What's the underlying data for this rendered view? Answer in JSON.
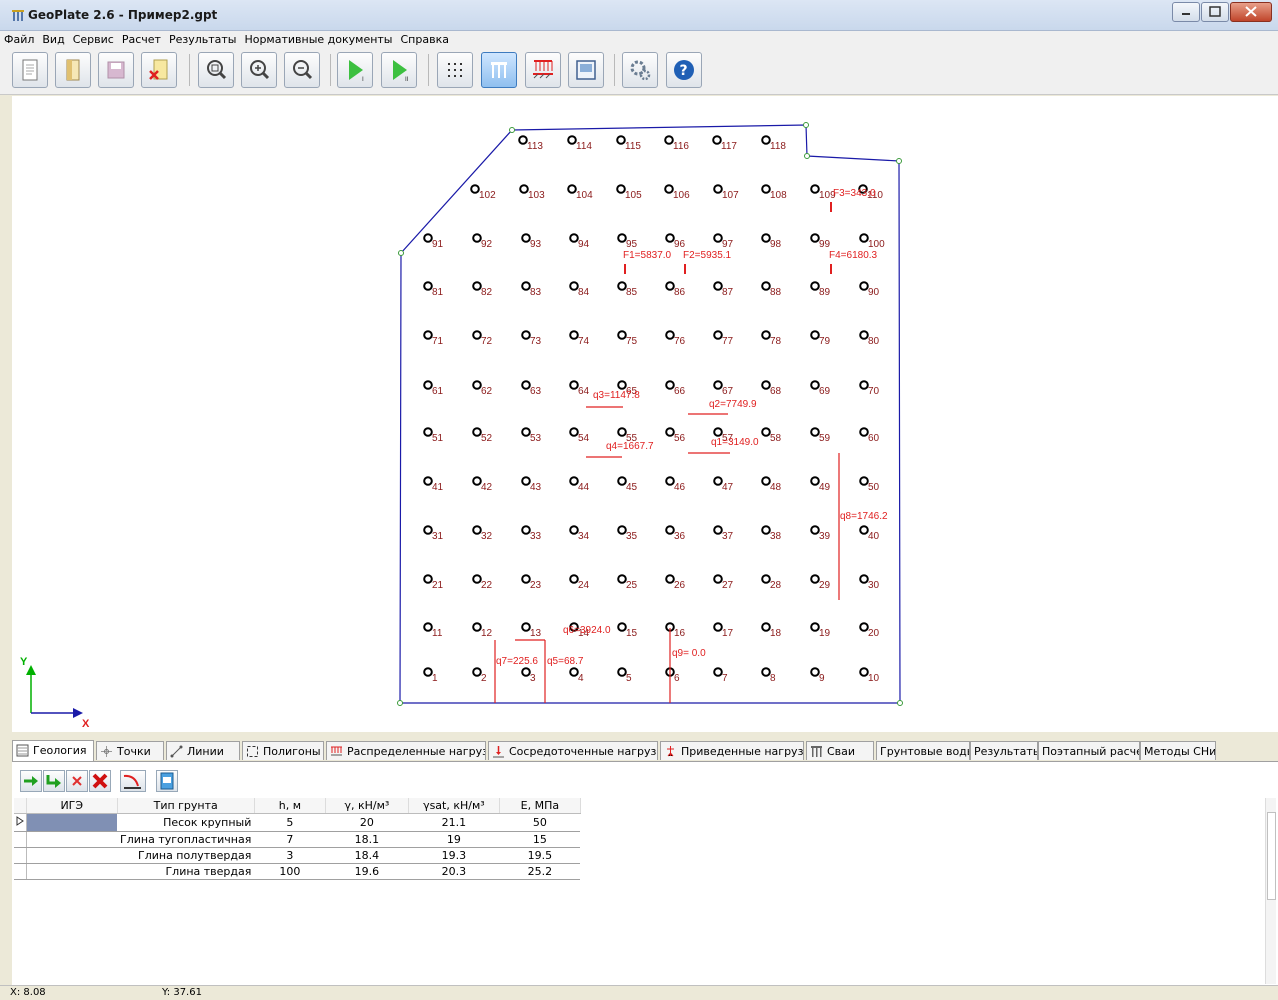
{
  "window": {
    "title": "GeoPlate 2.6  -  Пример2.gpt"
  },
  "menu": [
    "Файл",
    "Вид",
    "Сервис",
    "Расчет",
    "Результаты",
    "Нормативные документы",
    "Справка"
  ],
  "toolbar": {
    "buttons": [
      {
        "name": "new-file",
        "icon": "new-file-icon"
      },
      {
        "name": "open-file",
        "icon": "open-folder-icon"
      },
      {
        "name": "save-file",
        "icon": "save-icon"
      },
      {
        "name": "close-file",
        "icon": "close-file-icon"
      },
      {
        "name": "zoom-fit",
        "icon": "zoom-fit-icon"
      },
      {
        "name": "zoom-in",
        "icon": "zoom-in-icon"
      },
      {
        "name": "zoom-out",
        "icon": "zoom-out-icon"
      },
      {
        "name": "run-calc-1",
        "icon": "play-icon"
      },
      {
        "name": "run-calc-2",
        "icon": "play-icon"
      },
      {
        "name": "show-grid",
        "icon": "grid-dots-icon"
      },
      {
        "name": "show-piles",
        "icon": "piles-icon"
      },
      {
        "name": "show-loads",
        "icon": "distributed-load-icon"
      },
      {
        "name": "report",
        "icon": "report-icon"
      },
      {
        "name": "settings",
        "icon": "gear-icon"
      },
      {
        "name": "help",
        "icon": "help-icon"
      }
    ]
  },
  "drawing": {
    "axis_x_label": "X",
    "axis_y_label": "Y",
    "pile_ids": [
      [
        "113",
        "114",
        "115",
        "116",
        "117",
        "118"
      ],
      [
        "102",
        "103",
        "104",
        "105",
        "106",
        "107",
        "108",
        "109",
        "110"
      ],
      [
        "91",
        "92",
        "93",
        "94",
        "95",
        "96",
        "97",
        "98",
        "99",
        "100"
      ],
      [
        "81",
        "82",
        "83",
        "84",
        "85",
        "86",
        "87",
        "88",
        "89",
        "90"
      ],
      [
        "71",
        "72",
        "73",
        "74",
        "75",
        "76",
        "77",
        "78",
        "79",
        "80"
      ],
      [
        "61",
        "62",
        "63",
        "64",
        "65",
        "66",
        "67",
        "68",
        "69",
        "70"
      ],
      [
        "51",
        "52",
        "53",
        "54",
        "55",
        "56",
        "57",
        "58",
        "59",
        "60"
      ],
      [
        "41",
        "42",
        "43",
        "44",
        "45",
        "46",
        "47",
        "48",
        "49",
        "50"
      ],
      [
        "31",
        "32",
        "33",
        "34",
        "35",
        "36",
        "37",
        "38",
        "39",
        "40"
      ],
      [
        "21",
        "22",
        "23",
        "24",
        "25",
        "26",
        "27",
        "28",
        "29",
        "30"
      ],
      [
        "11",
        "12",
        "13",
        "14",
        "15",
        "16",
        "17",
        "18",
        "19",
        "20"
      ],
      [
        "1",
        "2",
        "3",
        "4",
        "5",
        "6",
        "7",
        "8",
        "9",
        "10"
      ]
    ],
    "point_loads": [
      {
        "label": "F1=5837.0"
      },
      {
        "label": "F2=5935.1"
      },
      {
        "label": "F3=343.0"
      },
      {
        "label": "F4=6180.3"
      }
    ],
    "line_loads": [
      {
        "label": "q1=3149.0"
      },
      {
        "label": "q2=7749.9"
      },
      {
        "label": "q3=1147.8"
      },
      {
        "label": "q4=1667.7"
      },
      {
        "label": "q5=68.7"
      },
      {
        "label": "q6=3924.0"
      },
      {
        "label": "q7=225.6"
      },
      {
        "label": "q8=1746.2"
      },
      {
        "label": "q9= 0.0"
      }
    ],
    "colors": {
      "outline": "#1a1aa8",
      "load": "#e02020",
      "pile": "#000000",
      "pile_label": "#8b1a1a",
      "axis_x": "#1a1aa8",
      "axis_y": "#00b000"
    }
  },
  "tabs": [
    {
      "label": "Геология",
      "icon": "geology-icon",
      "active": true
    },
    {
      "label": "Точки",
      "icon": "point-icon"
    },
    {
      "label": "Линии",
      "icon": "line-icon"
    },
    {
      "label": "Полигоны",
      "icon": "polygon-icon"
    },
    {
      "label": "Распределенные нагрузки",
      "icon": "distributed-load-icon"
    },
    {
      "label": "Сосредоточенные нагрузки",
      "icon": "point-load-icon"
    },
    {
      "label": "Приведенные нагрузки",
      "icon": "reduced-load-icon"
    },
    {
      "label": "Сваи",
      "icon": "piles-icon"
    },
    {
      "label": "Грунтовые воды"
    },
    {
      "label": "Результаты"
    },
    {
      "label": "Поэтапный расчет"
    },
    {
      "label": "Методы СНиП"
    }
  ],
  "geology_table": {
    "columns": [
      "ИГЭ",
      "Тип грунта",
      "h, м",
      "γ, кН/м³",
      "γsat, кН/м³",
      "E, МПа"
    ],
    "rows": [
      [
        "",
        "Песок крупный",
        "5",
        "20",
        "21.1",
        "50"
      ],
      [
        "",
        "Глина тугопластичная",
        "7",
        "18.1",
        "19",
        "15"
      ],
      [
        "",
        "Глина полутвердая",
        "3",
        "18.4",
        "19.3",
        "19.5"
      ],
      [
        "",
        "Глина твердая",
        "100",
        "19.6",
        "20.3",
        "25.2"
      ]
    ]
  },
  "status": {
    "x": "X: 8.08",
    "y": "Y: 37.61"
  }
}
